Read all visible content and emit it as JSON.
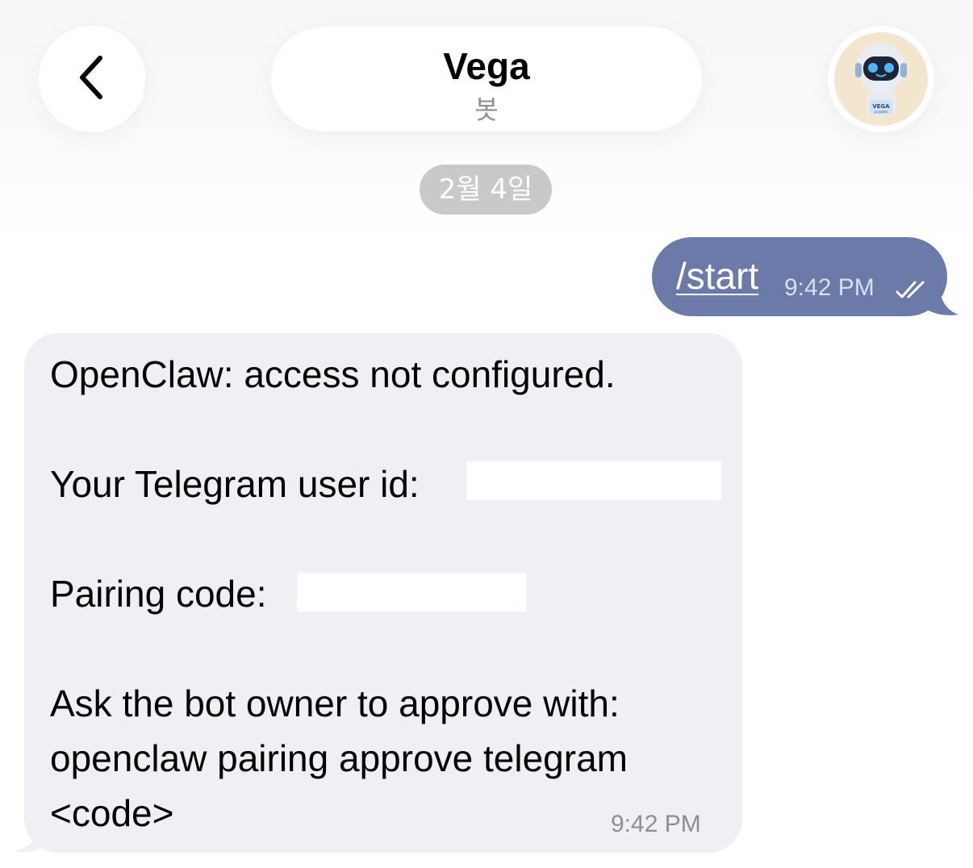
{
  "header": {
    "back_icon": "chevron-left-icon",
    "title": "Vega",
    "subtitle": "봇",
    "avatar": {
      "icon": "robot-avatar-icon",
      "badge_text": "VEGA",
      "badge_subtext": "AI AGENT"
    }
  },
  "date_separator": "2월 4일",
  "messages": [
    {
      "direction": "outgoing",
      "text": "/start",
      "time": "9:42 PM",
      "status_icon": "double-check-icon"
    },
    {
      "direction": "incoming",
      "lines": {
        "line1": "OpenClaw: access not configured.",
        "line2_label": "Your Telegram user id:",
        "line3_label": "Pairing code:",
        "line4": "Ask the bot owner to approve with:",
        "line5": "openclaw pairing approve telegram",
        "line6": "<code>"
      },
      "time": "9:42 PM"
    }
  ],
  "colors": {
    "outgoing_bubble": "#6b7aa9",
    "incoming_bubble": "#efeff4",
    "date_chip": "#c9c9cc",
    "time_muted": "#8e8e93"
  }
}
